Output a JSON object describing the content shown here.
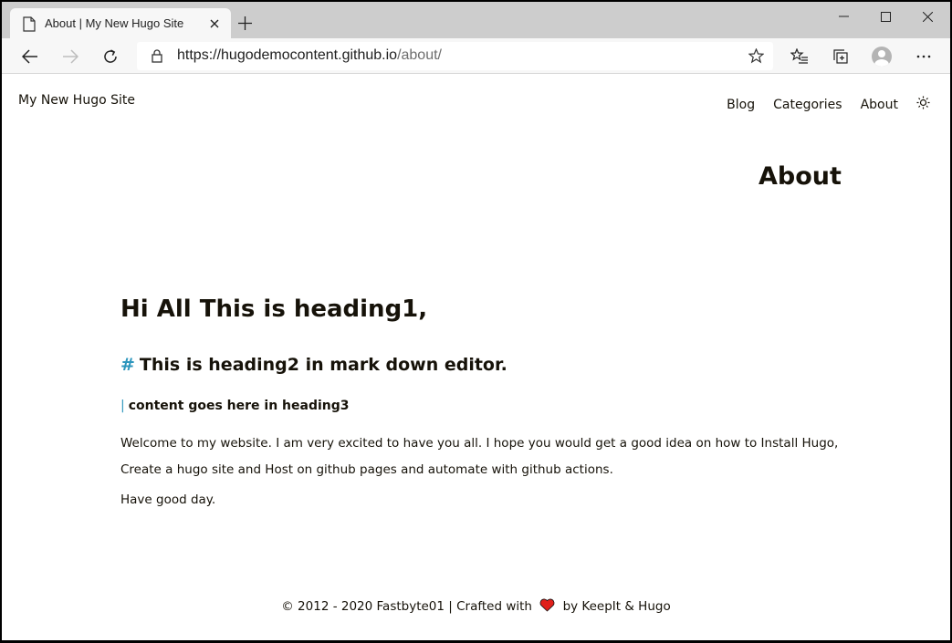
{
  "browser": {
    "tab_title": "About | My New Hugo Site",
    "url_host": "https://hugodemocontent.github.io",
    "url_path": "/about/"
  },
  "site": {
    "title": "My New Hugo Site",
    "nav": [
      {
        "label": "Blog"
      },
      {
        "label": "Categories"
      },
      {
        "label": "About"
      }
    ],
    "theme_toggle_icon": "sun-icon"
  },
  "page": {
    "heading": "About",
    "h1": "Hi All This is heading1,",
    "h2_anchor": "#",
    "h2": "This is heading2 in mark down editor.",
    "h3_marker": "|",
    "h3": "content goes here in heading3",
    "paragraph1": "Welcome to my website. I am very excited to have you all. I hope you would get a good idea on how to Install Hugo, Create a hugo site and Host on github pages and automate with github actions.",
    "paragraph2": "Have good day."
  },
  "footer": {
    "text_before": "© 2012 - 2020 Fastbyte01 | Crafted with",
    "text_after": "by KeepIt & Hugo",
    "heart_color": "#e0201b"
  },
  "colors": {
    "accent": "#2d96bd",
    "text": "#161209"
  }
}
